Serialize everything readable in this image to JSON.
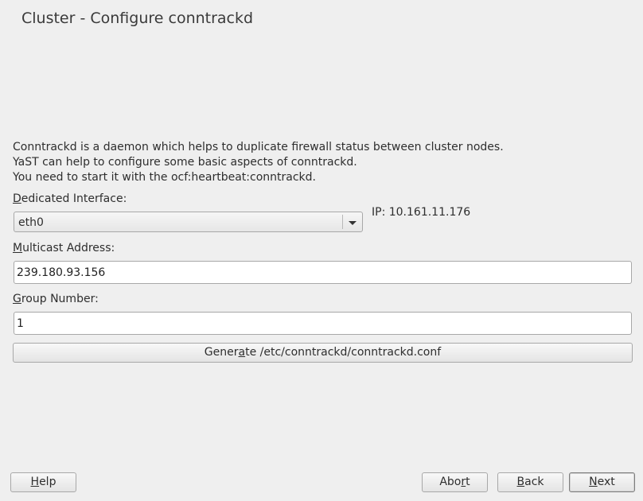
{
  "window": {
    "title": "Cluster - Configure conntrackd"
  },
  "description": {
    "lines": [
      "Conntrackd is a daemon which helps to duplicate firewall status between cluster nodes.",
      "YaST can help to configure some basic aspects of conntrackd.",
      "You need to start it with the ocf:heartbeat:conntrackd."
    ]
  },
  "interface": {
    "label_mnemonic": "D",
    "label_rest": "edicated Interface:",
    "value": "eth0",
    "ip_text": "IP: 10.161.11.176"
  },
  "multicast": {
    "label_mnemonic": "M",
    "label_rest": "ulticast Address:",
    "value": "239.180.93.156"
  },
  "group": {
    "label_mnemonic": "G",
    "label_rest": "roup Number:",
    "value": "1"
  },
  "generate_button": {
    "pre": "Gener",
    "mnemonic": "a",
    "post": "te /etc/conntrackd/conntrackd.conf"
  },
  "footer": {
    "help": {
      "mnemonic": "H",
      "rest": "elp"
    },
    "abort": {
      "pre": "Abo",
      "mnemonic": "r",
      "post": "t"
    },
    "back": {
      "mnemonic": "B",
      "rest": "ack"
    },
    "next": {
      "mnemonic": "N",
      "rest": "ext"
    }
  }
}
